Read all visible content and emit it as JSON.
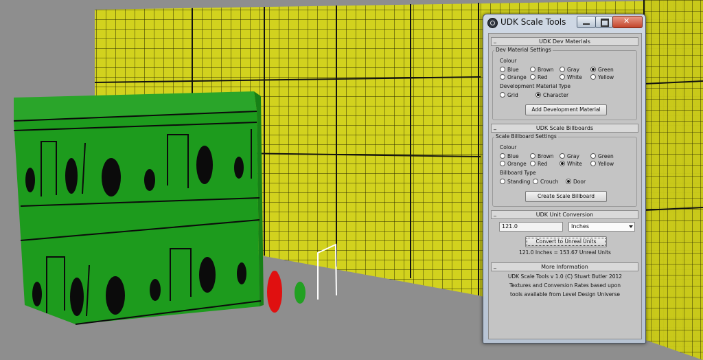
{
  "window": {
    "title": "UDK Scale Tools",
    "icon": "max-icon"
  },
  "rollout_toggle": "_",
  "dev": {
    "rollout_title": "UDK Dev Materials",
    "group_label": "Dev Material Settings",
    "colour_label": "Colour",
    "colours": [
      "Blue",
      "Brown",
      "Gray",
      "Green",
      "Orange",
      "Red",
      "White",
      "Yellow"
    ],
    "selected_colour": "Green",
    "type_label": "Development Material Type",
    "types": [
      "Grid",
      "Character"
    ],
    "selected_type": "Character",
    "button": "Add Development Material"
  },
  "billboards": {
    "rollout_title": "UDK Scale Billboards",
    "group_label": "Scale Billboard Settings",
    "colour_label": "Colour",
    "colours": [
      "Blue",
      "Brown",
      "Gray",
      "Green",
      "Orange",
      "Red",
      "White",
      "Yellow"
    ],
    "selected_colour": "White",
    "type_label": "Billboard Type",
    "types": [
      "Standing",
      "Crouch",
      "Door"
    ],
    "selected_type": "Door",
    "button": "Create Scale Billboard"
  },
  "conversion": {
    "rollout_title": "UDK Unit Conversion",
    "value": "121.0",
    "unit": "Inches",
    "button": "Convert to Unreal Units",
    "result": "121.0 Inches = 153.67 Unreal Units"
  },
  "info": {
    "rollout_title": "More Information",
    "lines": [
      "UDK Scale Tools v 1.0 (C) Stuart Butler 2012",
      "Textures and Conversion Rates based upon",
      "tools available from Level Design Universe"
    ]
  },
  "colors": {
    "floor": "#8e8e8e",
    "wall": "#d2d21e",
    "cube": "#1d9b1d",
    "red_figure": "#e01010",
    "green_figure": "#22a022",
    "door_outline": "#ffffff"
  }
}
